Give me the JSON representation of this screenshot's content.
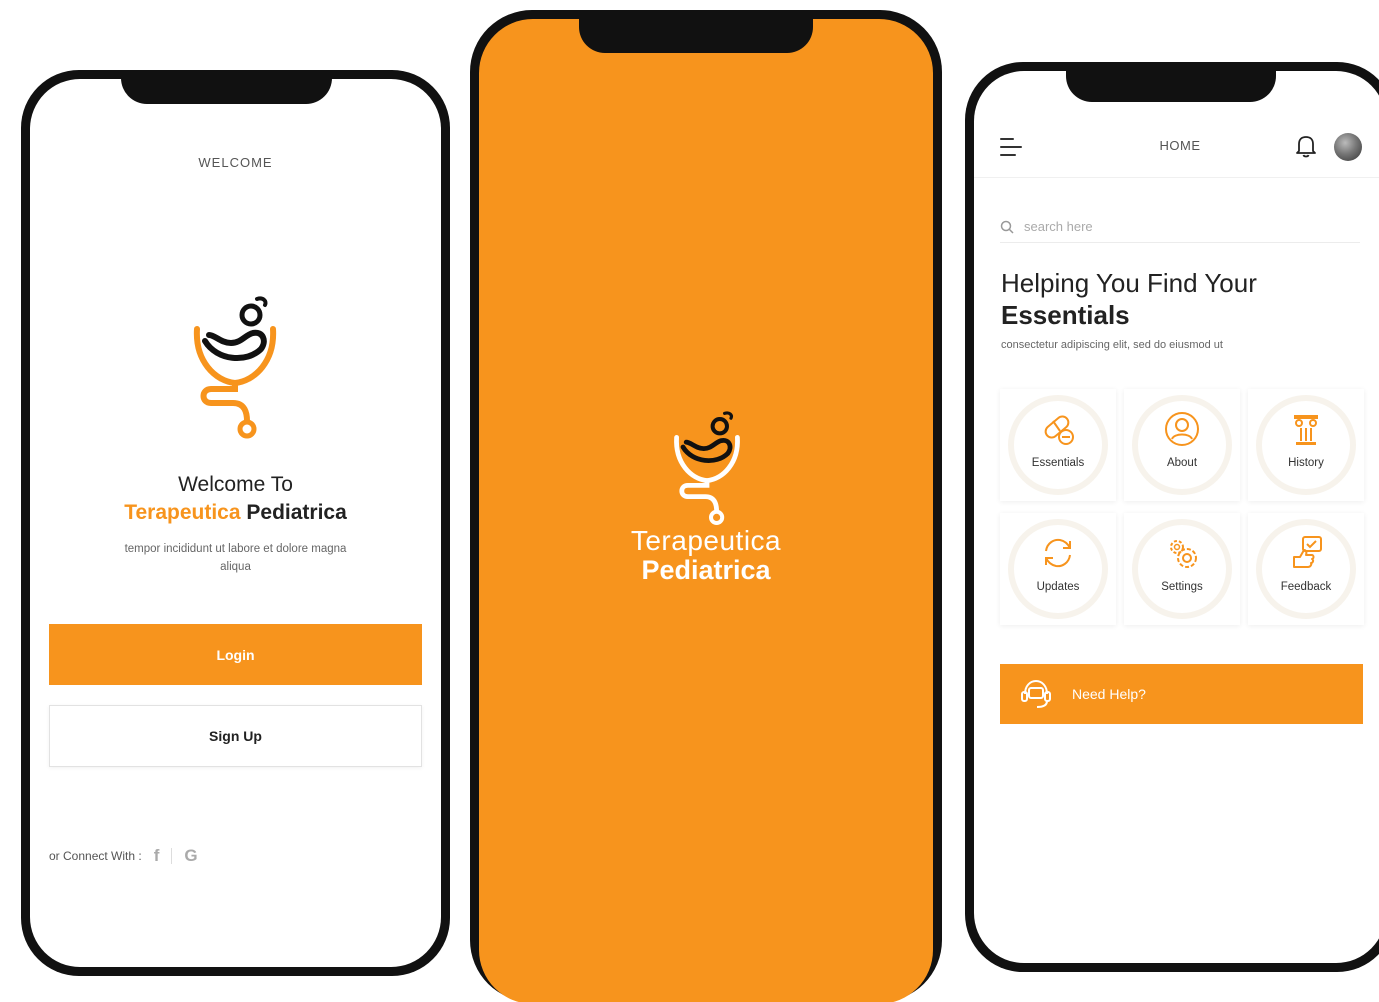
{
  "colors": {
    "accent": "#f7941d",
    "frame": "#111111",
    "text": "#222222"
  },
  "welcome_screen": {
    "header": "WELCOME",
    "logo": "terapeutica-logo",
    "title": "Welcome To",
    "brand_first": "Terapeutica",
    "brand_second": "Pediatrica",
    "description": "tempor incididunt ut labore et dolore magna aliqua",
    "login_label": "Login",
    "signup_label": "Sign Up",
    "connect_label": "or Connect With :",
    "social": [
      {
        "icon": "facebook-icon",
        "glyph": "f"
      },
      {
        "icon": "google-icon",
        "glyph": "G"
      }
    ]
  },
  "splash_screen": {
    "logo": "terapeutica-logo",
    "name_line1": "Terapeutica",
    "name_line2": "Pediatrica"
  },
  "home_screen": {
    "title": "HOME",
    "menu_icon": "hamburger-icon",
    "notification_icon": "bell-icon",
    "search_placeholder": "search here",
    "headline_line1": "Helping You Find Your",
    "headline_line2": "Essentials",
    "subtitle": "consectetur adipiscing elit, sed do eiusmod ut",
    "tiles": [
      {
        "label": "Essentials",
        "icon": "pills-icon"
      },
      {
        "label": "About",
        "icon": "user-icon"
      },
      {
        "label": "History",
        "icon": "column-icon"
      },
      {
        "label": "Updates",
        "icon": "refresh-icon"
      },
      {
        "label": "Settings",
        "icon": "gears-icon"
      },
      {
        "label": "Feedback",
        "icon": "feedback-icon"
      }
    ],
    "help_label": "Need Help?",
    "help_icon": "headset-icon"
  }
}
